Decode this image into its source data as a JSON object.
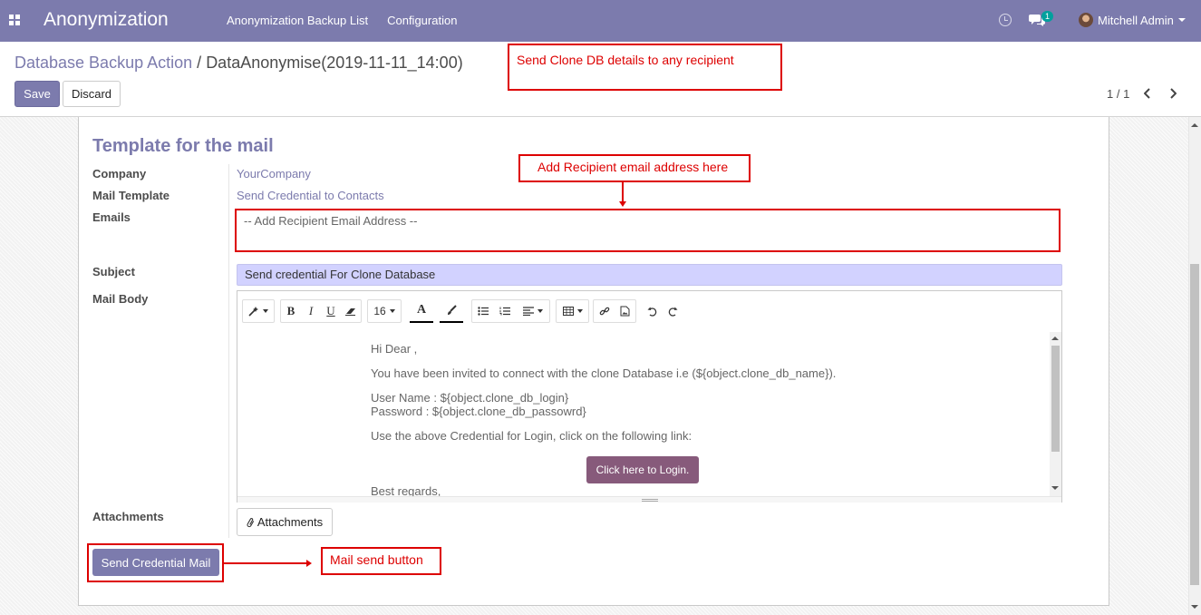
{
  "navbar": {
    "brand": "Anonymization",
    "menu": [
      "Anonymization Backup List",
      "Configuration"
    ],
    "chat_count": "1",
    "user_name": "Mitchell Admin"
  },
  "control_panel": {
    "breadcrumb_parent": "Database Backup Action",
    "breadcrumb_separator": "/",
    "breadcrumb_current": "DataAnonymise(2019-11-11_14:00)",
    "save_label": "Save",
    "discard_label": "Discard",
    "pager": "1 / 1"
  },
  "form": {
    "section_title": "Template for the mail",
    "company_label": "Company",
    "company_value": "YourCompany",
    "mail_template_label": "Mail Template",
    "mail_template_value": "Send Credential to Contacts",
    "emails_label": "Emails",
    "emails_placeholder": "-- Add Recipient Email Address --",
    "subject_label": "Subject",
    "subject_value": "Send credential For Clone Database",
    "mail_body_label": "Mail Body",
    "attachments_label": "Attachments",
    "attachments_button": "Attachments",
    "send_button": "Send Credential Mail"
  },
  "editor": {
    "font_size": "16",
    "bold": "B",
    "italic": "I",
    "underline": "U",
    "font_color": "A",
    "body": {
      "greeting": "Hi Dear ,",
      "invite": "You have been invited to connect with the clone Database i.e (${object.clone_db_name}).",
      "user_name": "User Name : ${object.clone_db_login}",
      "password": "Password : ${object.clone_db_passowrd}",
      "instruction": "Use the above Credential for Login, click on the following link:",
      "login_button": "Click here to Login.",
      "regards": "Best regards,"
    }
  },
  "annotations": {
    "clone_details": "Send Clone DB details to any recipient",
    "recipient": "Add Recipient email address here",
    "send": "Mail send button"
  },
  "colors": {
    "navbar": "#7c7bad",
    "primary": "#7c7bad",
    "login_button": "#875a7b",
    "subject_bg": "#d2d2ff",
    "annotation": "#dd0000"
  }
}
